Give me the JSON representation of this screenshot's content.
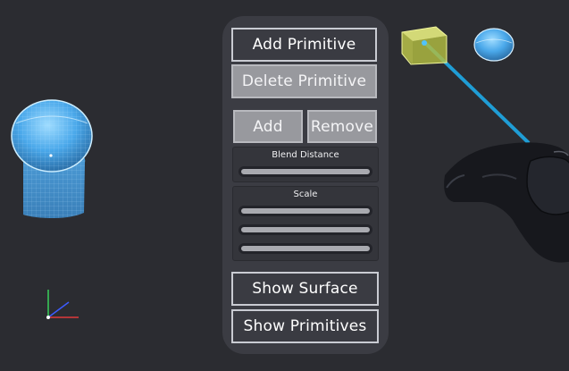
{
  "panel": {
    "add_primitive": "Add Primitive",
    "delete_primitive": "Delete Primitive",
    "add": "Add",
    "remove": "Remove",
    "blend_distance_label": "Blend Distance",
    "scale_label": "Scale",
    "scale_slider_count": 3,
    "show_surface": "Show Surface",
    "show_primitives": "Show Primitives"
  },
  "colors": {
    "background": "#2b2c31",
    "panel": "#3b3c43",
    "laser": "#1fa4de",
    "selected_box": "#d8e25a",
    "sphere_primitive": "#4fb3f0"
  },
  "icons": {
    "axis_gizmo": "axis-gizmo-icon",
    "controller": "vr-controller-icon"
  }
}
